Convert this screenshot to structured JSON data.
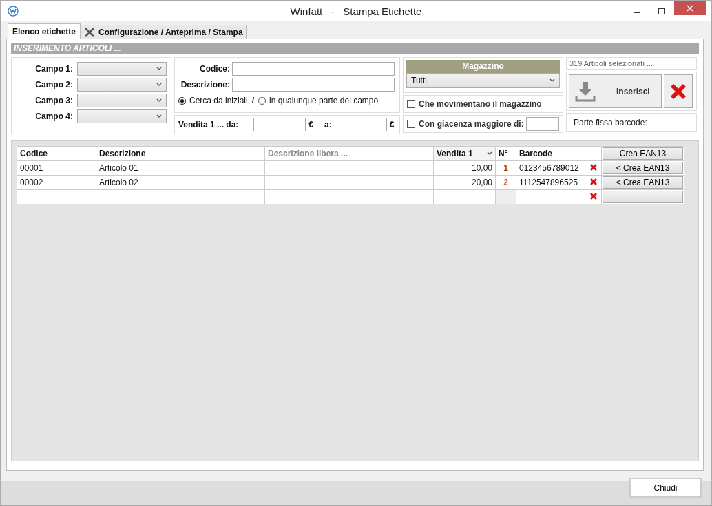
{
  "window": {
    "title": "Winfatt   -   Stampa Etichette"
  },
  "tabs": [
    {
      "label": "Elenco etichette",
      "selected": true,
      "has_icon": false
    },
    {
      "label": "Configurazione / Anteprima / Stampa",
      "selected": false,
      "has_icon": true
    }
  ],
  "section_title": "INSERIMENTO ARTICOLI ...",
  "campi": [
    {
      "label": "Campo 1:"
    },
    {
      "label": "Campo 2:"
    },
    {
      "label": "Campo 3:"
    },
    {
      "label": "Campo 4:"
    }
  ],
  "search": {
    "codice_label": "Codice:",
    "descrizione_label": "Descrizione:",
    "separator": "/",
    "radios": [
      {
        "label": "Cerca da iniziali",
        "selected": true
      },
      {
        "label": "in qualunque parte del campo",
        "selected": false
      }
    ]
  },
  "price": {
    "from_label": "Vendita 1 ... da:",
    "from_currency": "€",
    "to_label": "a:",
    "to_currency": "€"
  },
  "magazzino": {
    "header": "Magazzino",
    "value": "Tutti"
  },
  "checkboxes": [
    {
      "label": "Che movimentano il magazzino",
      "checked": false,
      "kind": "plain"
    },
    {
      "label": "Con giacenza maggiore di:",
      "checked": false,
      "kind": "input"
    }
  ],
  "count_text": "319 Articoli selezionati ...",
  "insert_button": "Inserisci",
  "barcode_label": "Parte fissa barcode:",
  "table": {
    "columns": [
      {
        "label": "Codice",
        "kind": "plain"
      },
      {
        "label": "Descrizione",
        "kind": "plain"
      },
      {
        "label": "Descrizione libera ...",
        "kind": "hint"
      },
      {
        "label": "Vendita 1",
        "kind": "sort"
      },
      {
        "label": "N°",
        "kind": "plain"
      },
      {
        "label": "Barcode",
        "kind": "plain"
      }
    ],
    "header_button": "Crea EAN13",
    "rows": [
      {
        "kind": "item",
        "codice": "00001",
        "descrizione": "Articolo 01",
        "vendita": "10,00",
        "n": "1",
        "barcode": "0123456789012",
        "action": "< Crea EAN13"
      },
      {
        "kind": "item",
        "codice": "00002",
        "descrizione": "Articolo 02",
        "vendita": "20,00",
        "n": "2",
        "barcode": "1112547896525",
        "action": "< Crea EAN13"
      },
      {
        "kind": "new"
      }
    ]
  },
  "footer": {
    "close_button": "Chiudi"
  }
}
